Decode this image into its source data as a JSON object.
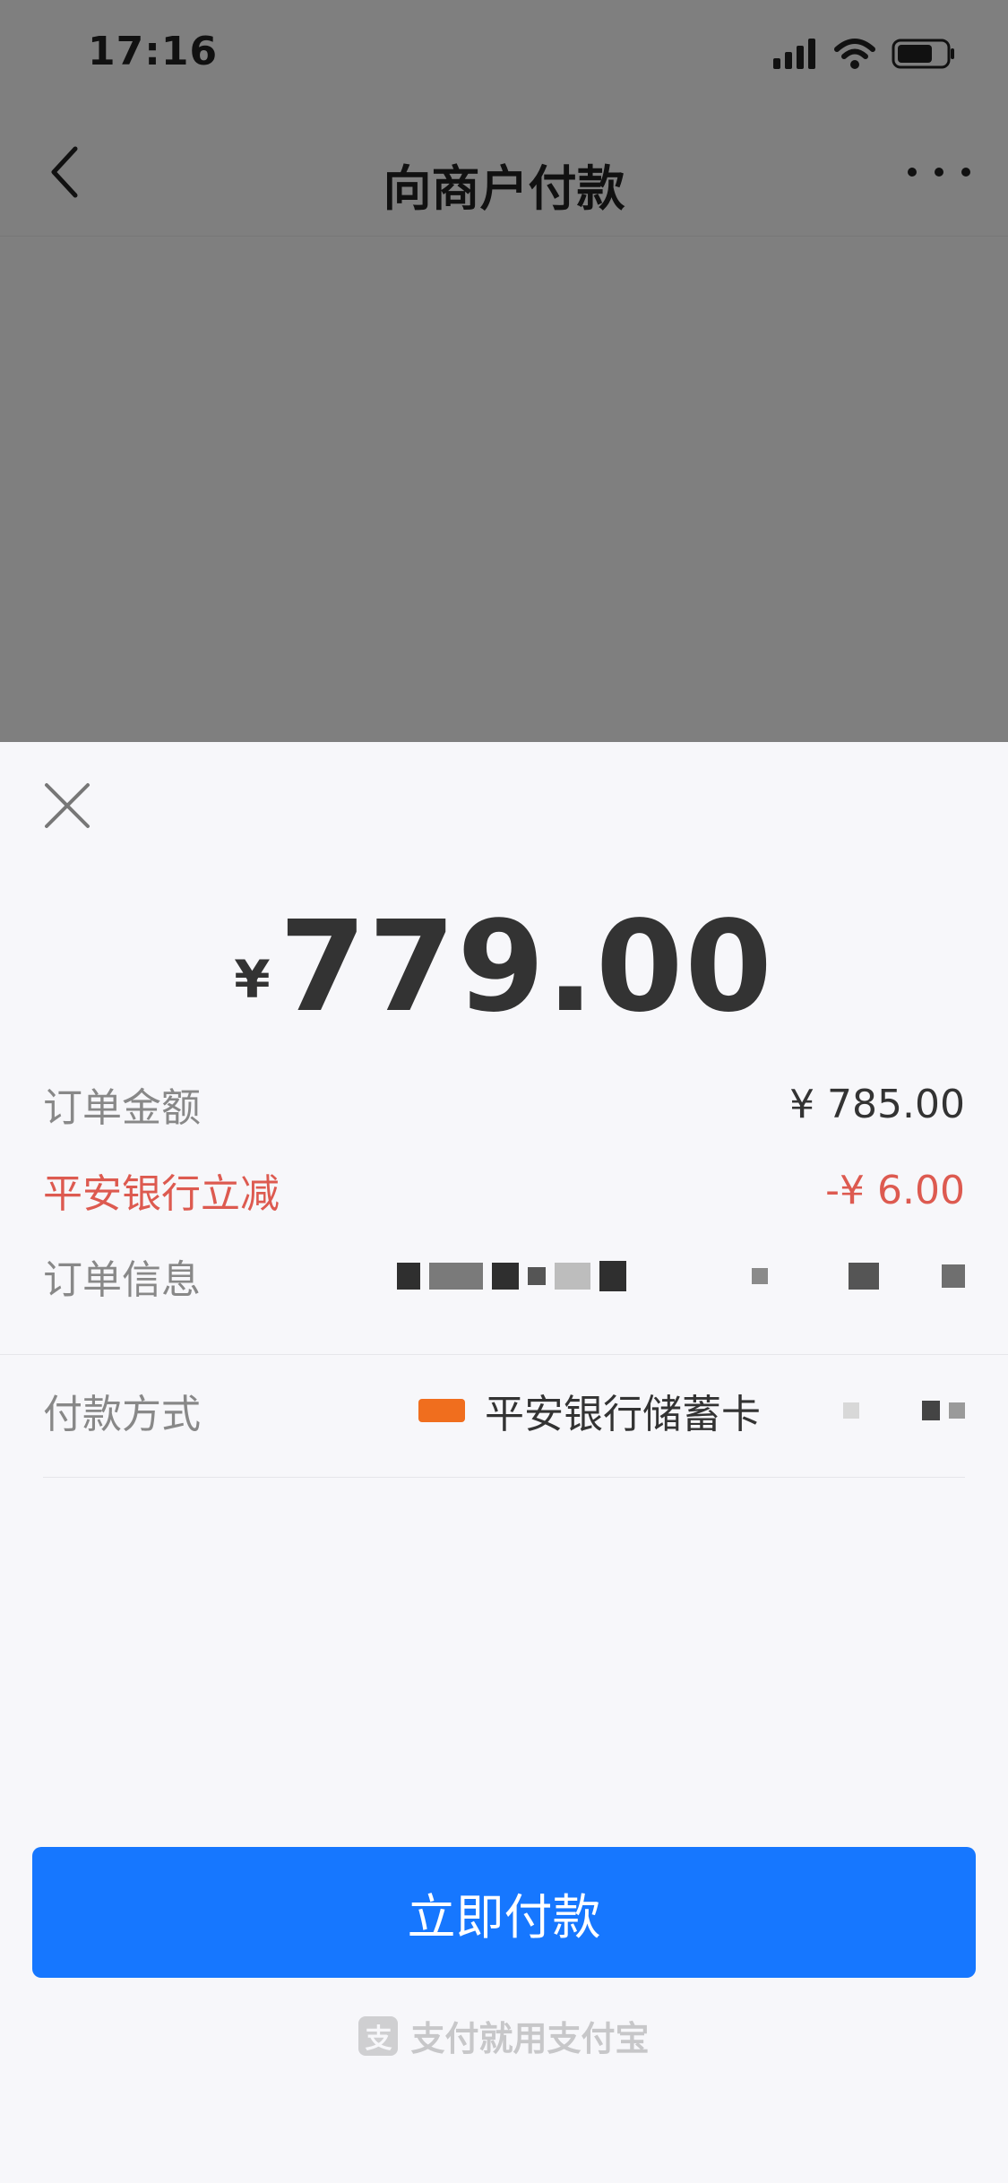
{
  "status_bar": {
    "time": "17:16"
  },
  "nav": {
    "title": "向商户付款"
  },
  "payment": {
    "currency_symbol": "¥",
    "amount": "779.00"
  },
  "rows": {
    "order_amount_label": "订单金额",
    "order_amount_value": "¥ 785.00",
    "discount_label": "平安银行立减",
    "discount_value": "-¥ 6.00",
    "order_info_label": "订单信息",
    "payment_method_label": "付款方式",
    "payment_method_value": "平安银行储蓄卡"
  },
  "actions": {
    "pay_now_label": "立即付款"
  },
  "footer": {
    "text": "支付就用支付宝",
    "icon_glyph": "支"
  },
  "colors": {
    "primary_blue": "#1677ff",
    "discount_red": "#dd5a50",
    "overlay_gray": "#7f7f7f"
  }
}
